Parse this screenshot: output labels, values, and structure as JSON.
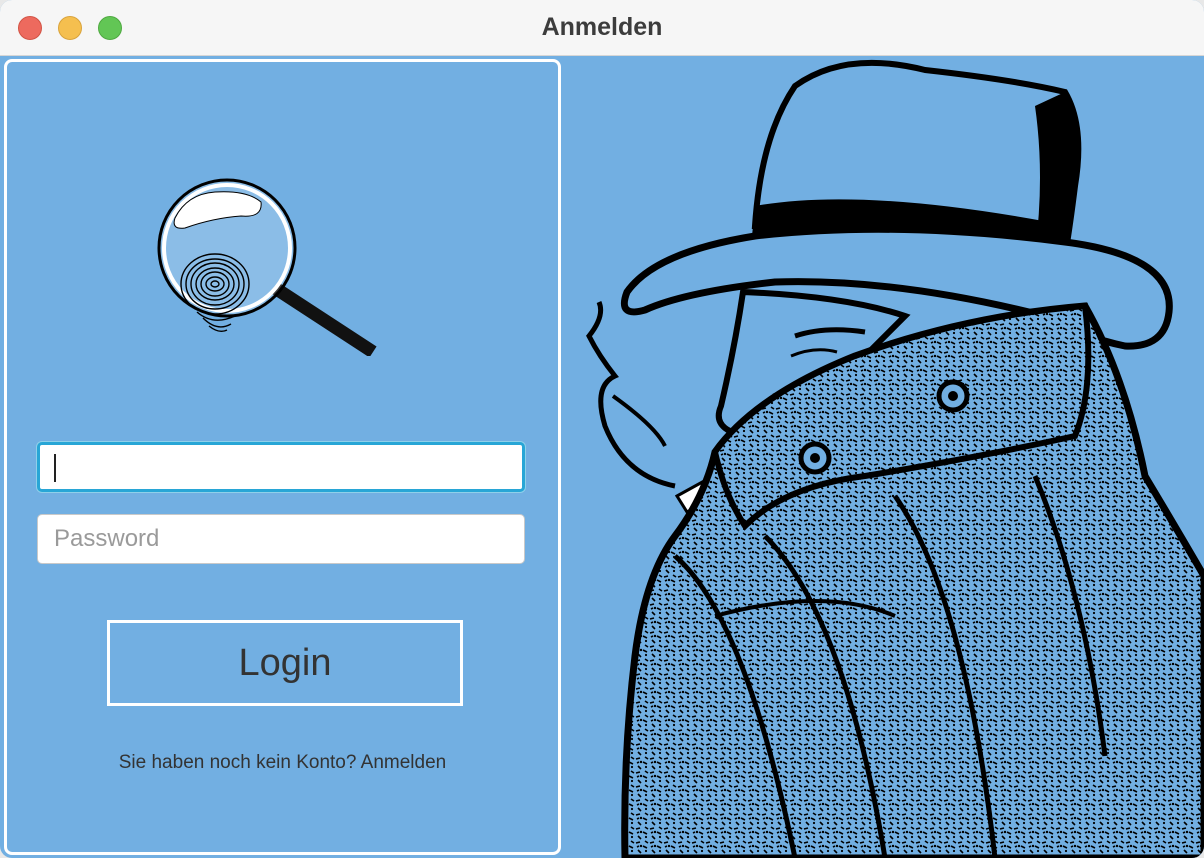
{
  "window": {
    "title": "Anmelden",
    "controls": [
      "close",
      "minimize",
      "zoom"
    ]
  },
  "login_form": {
    "logo_icon": "magnifier-fingerprint-icon",
    "username": {
      "value": "",
      "placeholder": ""
    },
    "password": {
      "value": "",
      "placeholder": "Password"
    },
    "login_label": "Login",
    "register_prompt": "Sie haben noch kein Konto? Anmelden"
  },
  "illustration": {
    "icon": "detective-icon"
  },
  "colors": {
    "panel_background": "#72afe2",
    "focus_ring": "#28a6d6",
    "text": "#333333"
  }
}
